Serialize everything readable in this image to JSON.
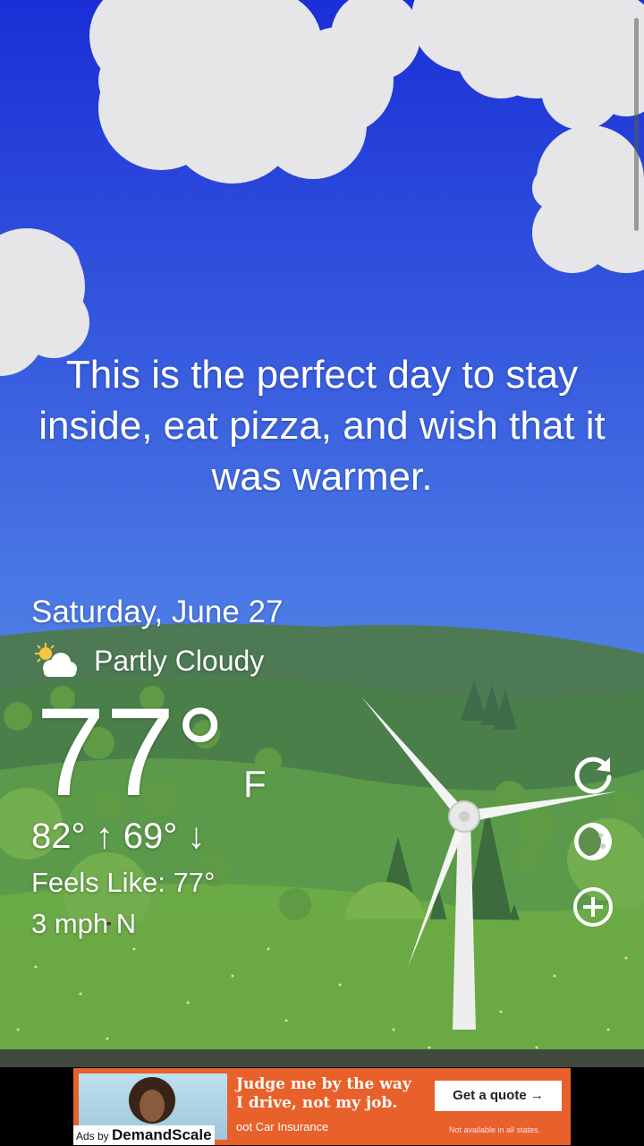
{
  "quote": "This is the perfect day to stay inside, eat pizza, and wish that it was warmer.",
  "weather": {
    "date": "Saturday, June 27",
    "condition": "Partly Cloudy",
    "condition_icon": "partly-cloudy-icon",
    "temperature": "77°",
    "unit": "F",
    "hi_lo": "82° ↑ 69° ↓",
    "feels_like": "Feels Like: 77°",
    "wind": "3 mph N"
  },
  "actions": {
    "refresh_icon": "refresh-icon",
    "share_icon": "moon-icon",
    "add_icon": "plus-circle-icon"
  },
  "ad": {
    "headline": "Judge me by the way I drive, not my job.",
    "cta": "Get a quote →",
    "brand": "oot Car Insurance",
    "disclaimer": "Not available in all states.",
    "ads_by_prefix": "Ads by",
    "ads_by_network": "DemandScale"
  },
  "colors": {
    "sky_top": "#1a2fd6",
    "sky_bottom": "#5c8eea",
    "ad_orange": "#e8602a"
  }
}
